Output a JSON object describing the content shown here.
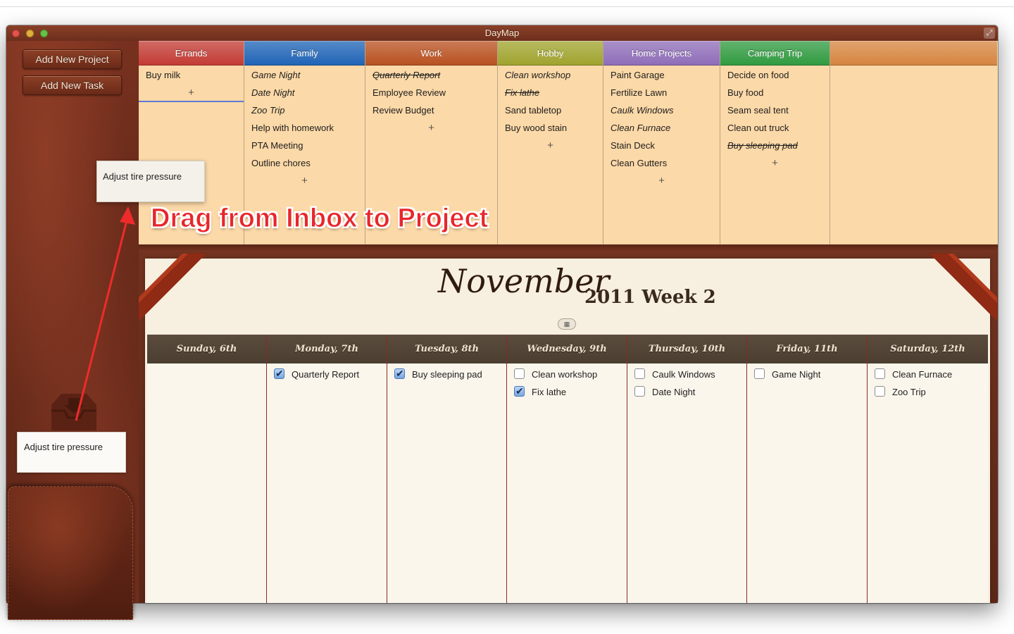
{
  "window": {
    "title": "DayMap"
  },
  "sidebar": {
    "add_project_label": "Add New Project",
    "add_task_label": "Add New Task",
    "inbox_note": "Adjust tire pressure",
    "dragging_note": "Adjust tire pressure"
  },
  "projects": [
    {
      "name": "Errands",
      "color": "#c23a33",
      "items": [
        {
          "text": "Buy milk",
          "style": "normal"
        }
      ]
    },
    {
      "name": "Family",
      "color": "#1e63b5",
      "items": [
        {
          "text": "Game Night",
          "style": "italic"
        },
        {
          "text": "Date Night",
          "style": "italic"
        },
        {
          "text": "Zoo Trip",
          "style": "italic"
        },
        {
          "text": "Help with homework",
          "style": "normal"
        },
        {
          "text": "PTA Meeting",
          "style": "normal"
        },
        {
          "text": "Outline chores",
          "style": "normal"
        }
      ]
    },
    {
      "name": "Work",
      "color": "#b8501f",
      "items": [
        {
          "text": "Quarterly Report",
          "style": "done"
        },
        {
          "text": "Employee Review",
          "style": "normal"
        },
        {
          "text": "Review Budget",
          "style": "normal"
        }
      ]
    },
    {
      "name": "Hobby",
      "color": "#9fa32c",
      "items": [
        {
          "text": "Clean workshop",
          "style": "italic"
        },
        {
          "text": "Fix lathe",
          "style": "done"
        },
        {
          "text": "Sand tabletop",
          "style": "normal"
        },
        {
          "text": "Buy wood stain",
          "style": "normal"
        }
      ]
    },
    {
      "name": "Home Projects",
      "color": "#8e6cb8",
      "items": [
        {
          "text": "Paint Garage",
          "style": "normal"
        },
        {
          "text": "Fertilize Lawn",
          "style": "normal"
        },
        {
          "text": "Caulk Windows",
          "style": "italic"
        },
        {
          "text": "Clean Furnace",
          "style": "italic"
        },
        {
          "text": "Stain Deck",
          "style": "normal"
        },
        {
          "text": "Clean Gutters",
          "style": "normal"
        }
      ]
    },
    {
      "name": "Camping Trip",
      "color": "#2f9a3f",
      "items": [
        {
          "text": "Decide on food",
          "style": "normal"
        },
        {
          "text": "Buy food",
          "style": "normal"
        },
        {
          "text": "Seam seal tent",
          "style": "normal"
        },
        {
          "text": "Clean out truck",
          "style": "normal"
        },
        {
          "text": "Buy sleeping pad",
          "style": "done"
        }
      ]
    },
    {
      "name": "",
      "color": "#d6843e",
      "items": []
    }
  ],
  "add_symbol": "+",
  "calendar": {
    "month": "November",
    "year_week": "2011  Week 2",
    "toggle_icon": "▦",
    "days": [
      {
        "label": "Sunday, 6th",
        "tasks": []
      },
      {
        "label": "Monday, 7th",
        "tasks": [
          {
            "text": "Quarterly Report",
            "checked": true
          }
        ]
      },
      {
        "label": "Tuesday, 8th",
        "tasks": [
          {
            "text": "Buy sleeping pad",
            "checked": true
          }
        ]
      },
      {
        "label": "Wednesday, 9th",
        "tasks": [
          {
            "text": "Clean workshop",
            "checked": false
          },
          {
            "text": "Fix lathe",
            "checked": true
          }
        ]
      },
      {
        "label": "Thursday, 10th",
        "tasks": [
          {
            "text": "Caulk Windows",
            "checked": false
          },
          {
            "text": "Date Night",
            "checked": false
          }
        ]
      },
      {
        "label": "Friday, 11th",
        "tasks": [
          {
            "text": "Game Night",
            "checked": false
          }
        ]
      },
      {
        "label": "Saturday, 12th",
        "tasks": [
          {
            "text": "Clean Furnace",
            "checked": false
          },
          {
            "text": "Zoo Trip",
            "checked": false
          }
        ]
      }
    ]
  },
  "annotation": {
    "text": "Drag from Inbox to Project",
    "color": "#e8262b"
  }
}
